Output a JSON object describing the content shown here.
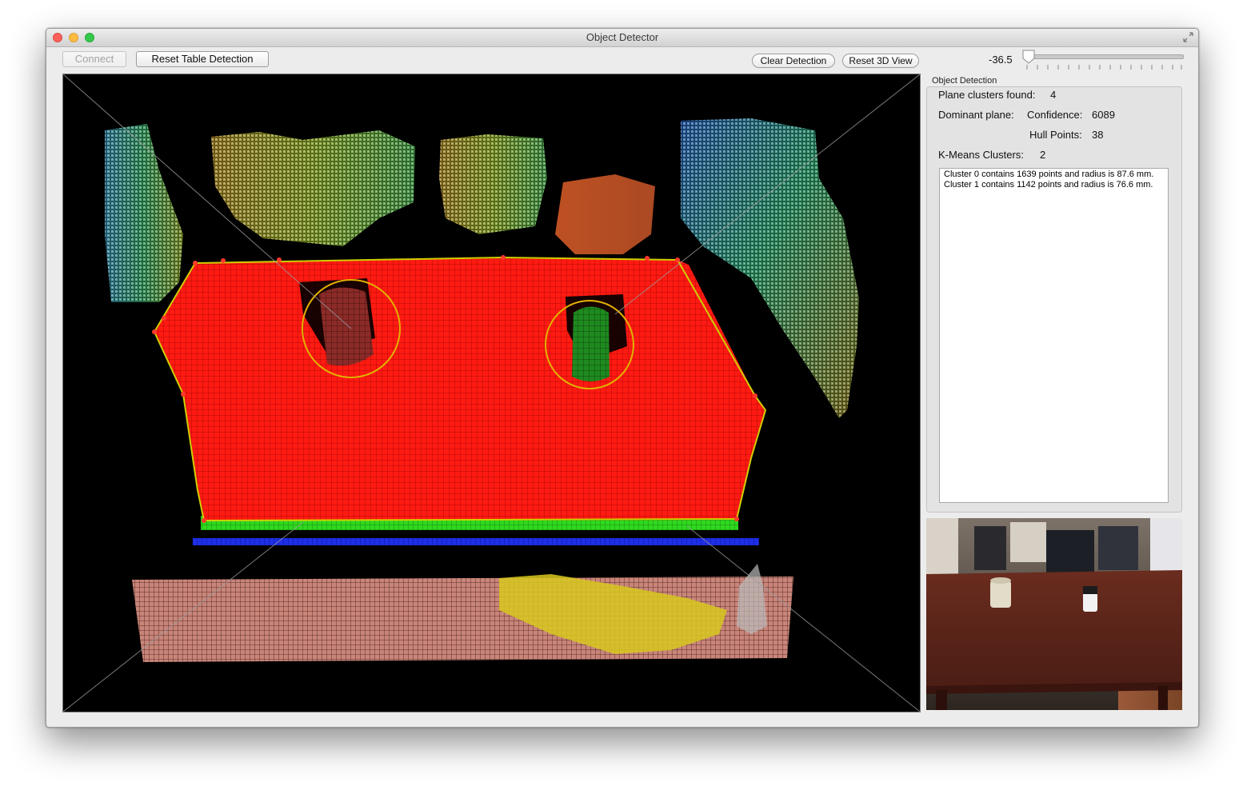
{
  "window": {
    "title": "Object Detector"
  },
  "toolbar": {
    "connect_label": "Connect",
    "reset_table_label": "Reset Table Detection",
    "clear_detection_label": "Clear Detection",
    "reset_3d_view_label": "Reset 3D View",
    "slider_value": "-36.5"
  },
  "panel": {
    "title": "Object Detection",
    "plane_clusters_label": "Plane clusters found:",
    "plane_clusters_value": "4",
    "dominant_plane_label": "Dominant plane:",
    "confidence_label": "Confidence:",
    "confidence_value": "6089",
    "hull_points_label": "Hull Points:",
    "hull_points_value": "38",
    "kmeans_label": "K-Means Clusters:",
    "kmeans_value": "2",
    "log_lines": [
      "Cluster 0 contains 1639 points and radius is 87.6 mm.",
      "Cluster 1 contains 1142 points and radius is 76.6 mm."
    ]
  },
  "colors": {
    "table_plane": "#ff1a12",
    "object_0": "#8a2a28",
    "object_1": "#1f8a1f",
    "detection_circle": "#e3b100",
    "hull_outline": "#cfcf00"
  }
}
